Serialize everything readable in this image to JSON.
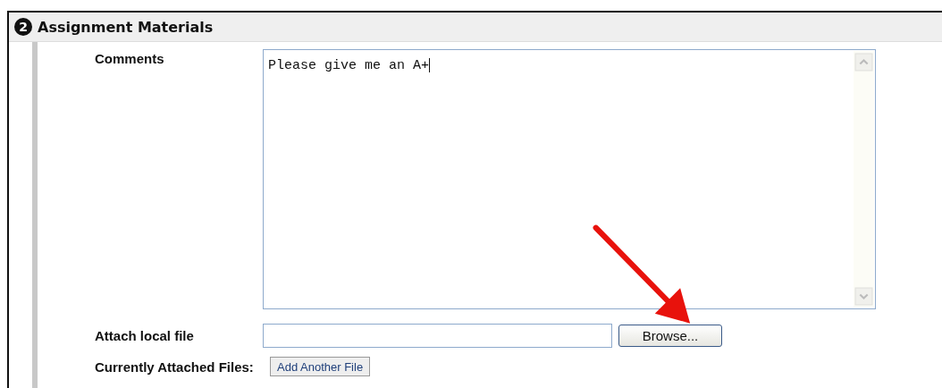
{
  "section": {
    "step": "2",
    "title": "Assignment Materials"
  },
  "comments": {
    "label": "Comments",
    "value": "Please give me an A+"
  },
  "attach": {
    "label": "Attach local file",
    "button": "Browse..."
  },
  "attached": {
    "label": "Currently Attached Files:",
    "button": "Add Another File"
  }
}
